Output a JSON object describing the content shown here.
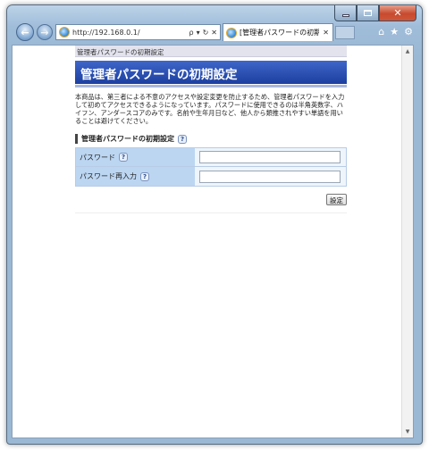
{
  "browser": {
    "url": "http://192.168.0.1/",
    "tab_title": "[管理者パスワードの初期...",
    "back_glyph": "←",
    "forward_glyph": "→",
    "search_glyph": "ρ",
    "dropdown_glyph": "▾",
    "refresh_glyph": "↻",
    "stop_glyph": "✕",
    "tab_close_glyph": "✕",
    "home_glyph": "⌂",
    "favorites_glyph": "★",
    "tools_glyph": "⚙",
    "close_glyph": "✕"
  },
  "page": {
    "breadcrumb": "管理者パスワードの初期設定",
    "title": "管理者パスワードの初期設定",
    "description": "本商品は、第三者による不意のアクセスや設定変更を防止するため、管理者パスワードを入力して初めてアクセスできるようになっています。パスワードに使用できるのは半角英数字、ハイフン、アンダースコアのみです。名前や生年月日など、他人から類推されやすい単語を用いることは避けてください。",
    "section_title": "管理者パスワードの初期設定",
    "help_glyph": "?",
    "fields": [
      {
        "label": "パスワード",
        "value": ""
      },
      {
        "label": "パスワード再入力",
        "value": ""
      }
    ],
    "submit_label": "設定"
  },
  "scrollbar": {
    "up_glyph": "▲",
    "down_glyph": "▼"
  }
}
